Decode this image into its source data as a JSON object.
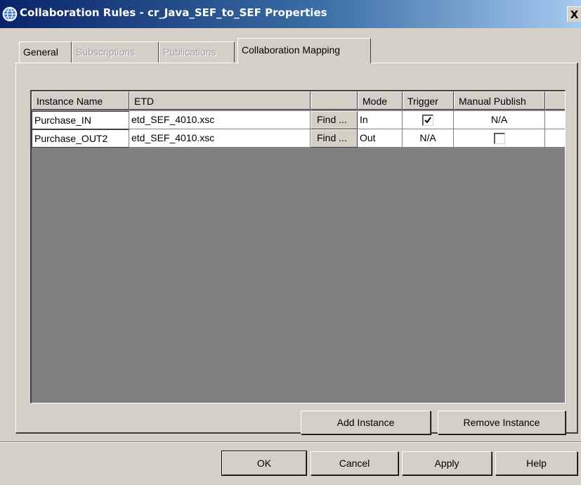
{
  "window": {
    "title": "Collaboration Rules - cr_Java_SEF_to_SEF Properties",
    "close_label": "X"
  },
  "tabs": [
    {
      "label": "General",
      "state": "enabled"
    },
    {
      "label": "Subscriptions",
      "state": "disabled"
    },
    {
      "label": "Publications",
      "state": "disabled"
    },
    {
      "label": "Collaboration Mapping",
      "state": "active"
    }
  ],
  "table": {
    "headers": [
      "Instance Name",
      "ETD",
      "",
      "Mode",
      "Trigger",
      "Manual Publish"
    ],
    "rows": [
      {
        "instance_name": "Purchase_IN",
        "etd": "etd_SEF_4010.xsc",
        "find_label": "Find ...",
        "mode": "In",
        "trigger": {
          "type": "checkbox",
          "checked": true
        },
        "manual_publish": {
          "type": "text",
          "value": "N/A"
        }
      },
      {
        "instance_name": "Purchase_OUT2",
        "etd": "etd_SEF_4010.xsc",
        "find_label": "Find ...",
        "mode": "Out",
        "trigger": {
          "type": "text",
          "value": "N/A"
        },
        "manual_publish": {
          "type": "checkbox",
          "checked": false
        }
      }
    ]
  },
  "instance_buttons": {
    "add": "Add Instance",
    "remove": "Remove Instance"
  },
  "dialog_buttons": {
    "ok": "OK",
    "cancel": "Cancel",
    "apply": "Apply",
    "help": "Help"
  },
  "colors": {
    "titlebar_start": "#0a246a",
    "titlebar_end": "#a6caf0",
    "dialog_bg": "#d4d0c8",
    "table_bg": "#808080"
  }
}
